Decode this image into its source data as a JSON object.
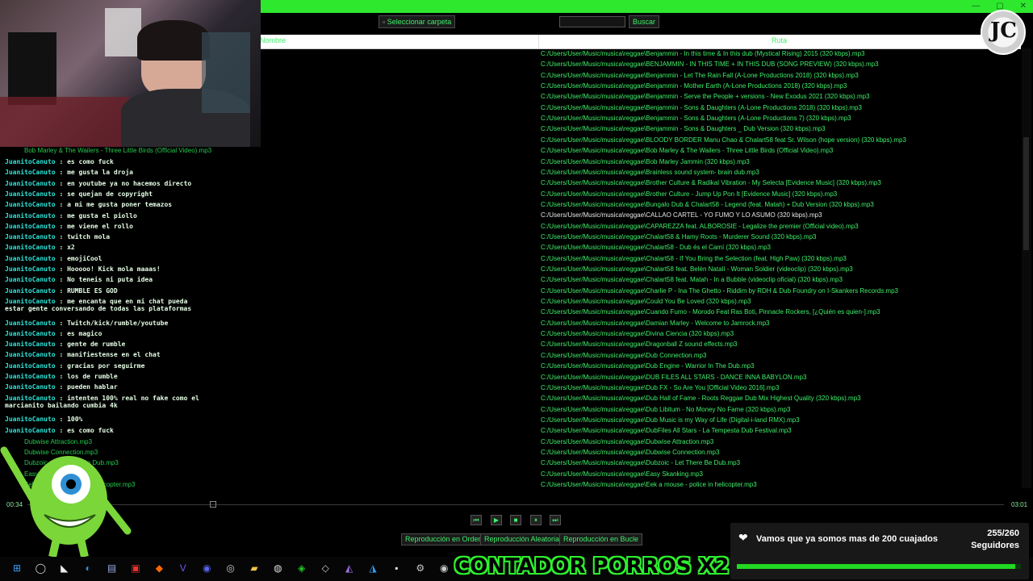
{
  "toolbar": {
    "select_folder_label": "Seleccionar carpeta",
    "search_placeholder": "",
    "search_label": "Buscar"
  },
  "columns": {
    "name": "Nombre",
    "path": "Ruta"
  },
  "files": [
    {
      "name": "",
      "path": "C:/Users/User/Music/musica\\reggae\\Benjammin - In this time & In this dub (Mystical Rising) 2015 (320 kbps).mp3"
    },
    {
      "name": "",
      "path": "C:/Users/User/Music/musica\\reggae\\BENJAMMIN - IN THIS TIME + IN THIS DUB (SONG PREVIEW) (320 kbps).mp3"
    },
    {
      "name": "",
      "path": "C:/Users/User/Music/musica\\reggae\\Benjammin - Let The Rain Fall (A-Lone Productions 2018) (320 kbps).mp3"
    },
    {
      "name": "",
      "path": "C:/Users/User/Music/musica\\reggae\\Benjammin - Mother Earth (A-Lone Productions 2018) (320 kbps).mp3"
    },
    {
      "name": "",
      "path": "C:/Users/User/Music/musica\\reggae\\Benjammin - Serve the People + versions - New Exodus 2021 (320 kbps).mp3"
    },
    {
      "name": "",
      "path": "C:/Users/User/Music/musica\\reggae\\Benjammin - Sons & Daughters (A-Lone Productions 2018) (320 kbps).mp3"
    },
    {
      "name": "",
      "path": "C:/Users/User/Music/musica\\reggae\\Benjammin - Sons & Daughters (A-Lone Productions 7) (320 kbps).mp3"
    },
    {
      "name": "",
      "path": "C:/Users/User/Music/musica\\reggae\\Benjammin - Sons & Daughters _ Dub Version (320 kbps).mp3"
    },
    {
      "name": "",
      "path": "C:/Users/User/Music/musica\\reggae\\BLOODY BORDER Manu Chao & Chalart58 feat Sr. Wilson (hope version) (320 kbps).mp3"
    },
    {
      "name": "Bob Marley & The Wailers - Three Little Birds (Official Video).mp3",
      "path": "C:/Users/User/Music/musica\\reggae\\Bob Marley & The Wailers - Three Little Birds (Official Video).mp3"
    },
    {
      "name": "",
      "path": "C:/Users/User/Music/musica\\reggae\\Bob Marley Jammin (320 kbps).mp3"
    },
    {
      "name": "",
      "path": "C:/Users/User/Music/musica\\reggae\\Brainless sound system- brain dub.mp3"
    },
    {
      "name": "",
      "path": "C:/Users/User/Music/musica\\reggae\\Brother Culture & Radikal Vibration - My Selecta [Evidence Music] (320 kbps).mp3"
    },
    {
      "name": "",
      "path": "C:/Users/User/Music/musica\\reggae\\Brother Culture - Jump Up Pon It [Evidence Music] (320 kbps).mp3"
    },
    {
      "name": "",
      "path": "C:/Users/User/Music/musica\\reggae\\Bungalo Dub & Chalart58 - Legend (feat. Matah) + Dub Version (320 kbps).mp3"
    },
    {
      "name": "",
      "path": "C:/Users/User/Music/musica\\reggae\\CALLAO CARTEL - YO FUMO Y LO ASUMO (320 kbps).mp3",
      "selected": true
    },
    {
      "name": "",
      "path": "C:/Users/User/Music/musica\\reggae\\CAPAREZZA feat. ALBOROSIE - Legalize the premier (Official video).mp3"
    },
    {
      "name": "",
      "path": "C:/Users/User/Music/musica\\reggae\\Chalart58 & Hamy Roots - Murderer Sound (320 kbps).mp3"
    },
    {
      "name": "",
      "path": "C:/Users/User/Music/musica\\reggae\\Chalart58 - Dub és el Camí (320 kbps).mp3"
    },
    {
      "name": "",
      "path": "C:/Users/User/Music/musica\\reggae\\Chalart58 - If You Bring the Selection (feat. High Paw) (320 kbps).mp3"
    },
    {
      "name": "",
      "path": "C:/Users/User/Music/musica\\reggae\\Chalart58 feat. Belén Natalí - Woman Soldier (videoclip) (320 kbps).mp3"
    },
    {
      "name": "",
      "path": "C:/Users/User/Music/musica\\reggae\\Chalart58 feat. Matah - In a Bubble (videoclip oficial) (320 kbps).mp3"
    },
    {
      "name": "",
      "path": "C:/Users/User/Music/musica\\reggae\\Charlie P - Ina The Ghetto - Riddim by RDH & Dub Foundry on I-Skankers Records.mp3"
    },
    {
      "name": "",
      "path": "C:/Users/User/Music/musica\\reggae\\Could You Be Loved (320 kbps).mp3"
    },
    {
      "name": "",
      "path": "C:/Users/User/Music/musica\\reggae\\Cuando Fumo - Morodo Feat Ras Boti, Pinnacle Rockers, [¿Quién es quien-].mp3"
    },
    {
      "name": "",
      "path": "C:/Users/User/Music/musica\\reggae\\Damian Marley - Welcome to Jamrock.mp3"
    },
    {
      "name": "",
      "path": "C:/Users/User/Music/musica\\reggae\\Divina Ciencia (320 kbps).mp3"
    },
    {
      "name": "",
      "path": "C:/Users/User/Music/musica\\reggae\\Dragonball Z sound effects.mp3"
    },
    {
      "name": "",
      "path": "C:/Users/User/Music/musica\\reggae\\Dub Connection.mp3"
    },
    {
      "name": "",
      "path": "C:/Users/User/Music/musica\\reggae\\Dub Engine - Warrior In The Dub.mp3"
    },
    {
      "name": "",
      "path": "C:/Users/User/Music/musica\\reggae\\DUB FILES ALL STARS - DANCE INNA BABYLON.mp3"
    },
    {
      "name": "",
      "path": "C:/Users/User/Music/musica\\reggae\\Dub FX - So Are You [Official Video 2016].mp3"
    },
    {
      "name": "",
      "path": "C:/Users/User/Music/musica\\reggae\\Dub Hall of Fame - Roots Reggae Dub Mix Highest Quality (320 kbps).mp3"
    },
    {
      "name": "",
      "path": "C:/Users/User/Music/musica\\reggae\\Dub Libitum - No Money No Fame (320 kbps).mp3"
    },
    {
      "name": "",
      "path": "C:/Users/User/Music/musica\\reggae\\Dub Music is my Way of Life (Digital-i-land RMX).mp3"
    },
    {
      "name": "",
      "path": "C:/Users/User/Music/musica\\reggae\\DubFiles All Stars - La Tempesta Dub Festival.mp3"
    },
    {
      "name": "Dubwise Attraction.mp3",
      "path": "C:/Users/User/Music/musica\\reggae\\Dubwise Attraction.mp3"
    },
    {
      "name": "Dubwise Connection.mp3",
      "path": "C:/Users/User/Music/musica\\reggae\\Dubwise Connection.mp3"
    },
    {
      "name": "Dubzoic - Let There Be Dub.mp3",
      "path": "C:/Users/User/Music/musica\\reggae\\Dubzoic - Let There Be Dub.mp3"
    },
    {
      "name": "Easy Skanking.mp3",
      "path": "C:/Users/User/Music/musica\\reggae\\Easy Skanking.mp3"
    },
    {
      "name": "Eek a mouse - police in helicopter.mp3",
      "path": "C:/Users/User/Music/musica\\reggae\\Eek a mouse - police in helicopter.mp3"
    }
  ],
  "chat": [
    {
      "user": "JuanitoCanuto",
      "text": " : es como fuck"
    },
    {
      "user": "JuanitoCanuto",
      "text": " : me gusta la droja"
    },
    {
      "user": "JuanitoCanuto",
      "text": " : en youtube ya no hacemos directo"
    },
    {
      "user": "JuanitoCanuto",
      "text": " : se quejan de copyright"
    },
    {
      "user": "JuanitoCanuto",
      "text": " : a mi me gusta poner temazos"
    },
    {
      "user": "JuanitoCanuto",
      "text": " : me gusta el piollo"
    },
    {
      "user": "JuanitoCanuto",
      "text": " : me viene el rollo"
    },
    {
      "user": "JuanitoCanuto",
      "text": " : twitch mola"
    },
    {
      "user": "JuanitoCanuto",
      "text": " : x2"
    },
    {
      "user": "JuanitoCanuto",
      "text": " : emojiCool"
    },
    {
      "user": "JuanitoCanuto",
      "text": " : Hooooo! Kick mola maaas!"
    },
    {
      "user": "JuanitoCanuto",
      "text": " : No teneis ni puta idea"
    },
    {
      "user": "JuanitoCanuto",
      "text": " : RUMBLE ES GOD"
    },
    {
      "user": "JuanitoCanuto",
      "text": " : me encanta que en mi chat pueda\nestar gente conversando de todas las plataformas"
    },
    {
      "user": "JuanitoCanuto",
      "text": " : Twitch/kick/rumble/youtube"
    },
    {
      "user": "JuanitoCanuto",
      "text": " : es magico"
    },
    {
      "user": "JuanitoCanuto",
      "text": " : gente de rumble"
    },
    {
      "user": "JuanitoCanuto",
      "text": " : manifiestense en el chat"
    },
    {
      "user": "JuanitoCanuto",
      "text": " : gracias por seguirme"
    },
    {
      "user": "JuanitoCanuto",
      "text": " : los de rumble"
    },
    {
      "user": "JuanitoCanuto",
      "text": " : pueden hablar"
    },
    {
      "user": "JuanitoCanuto",
      "text": " : intenten 100% real no fake como el\nmarcianito bailando cumbia 4k"
    },
    {
      "user": "JuanitoCanuto",
      "text": " : 100%"
    },
    {
      "user": "JuanitoCanuto",
      "text": " : es como fuck"
    }
  ],
  "player": {
    "elapsed": "00:34",
    "duration": "03:01",
    "progress": 0.19,
    "buttons": [
      "prev",
      "play",
      "stop",
      "pause",
      "next"
    ],
    "modes": [
      "Reproducción en Orden",
      "Reproducción Aleatoria",
      "Reproducción en Bucle"
    ]
  },
  "overlay": {
    "counter_text": "CONTADOR PORROS X2",
    "goal_text": "Vamos que ya somos mas de 200 cuajados",
    "goal_count": "255/260",
    "goal_label": "Seguidores",
    "goal_progress": 0.98,
    "logo_text": "JC"
  },
  "taskbar": {
    "icons": [
      "windows-icon",
      "search-icon",
      "capcut-icon",
      "edge-icon",
      "notepad-icon",
      "app-red-icon",
      "brave-icon",
      "vegas-icon",
      "discord-icon",
      "obs-icon",
      "folder-icon",
      "github-icon",
      "xbox-icon",
      "box-icon",
      "visualstudio-icon",
      "vscode-icon",
      "terminal-icon",
      "settings-icon",
      "steam-icon"
    ]
  },
  "colors": {
    "accent": "#2ee82e",
    "text": "#3ef06a",
    "user": "#2ce6d8"
  }
}
